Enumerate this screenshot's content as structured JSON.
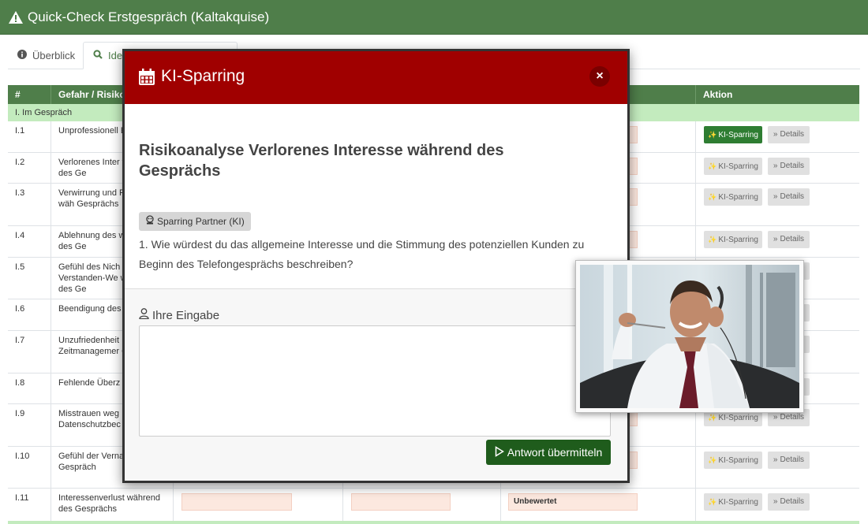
{
  "window": {
    "title": "Quick-Check Erstgespräch (Kaltakquise)"
  },
  "tabs": [
    {
      "label": "Überblick",
      "icon": "info-circle-icon"
    },
    {
      "label": "Ide",
      "icon": "search-icon"
    }
  ],
  "table": {
    "headers": [
      "#",
      "Gefahr / Risiko",
      "",
      "",
      "",
      "Aktion"
    ],
    "group_label": "I. Im Gespräch",
    "rows": [
      {
        "num": "I.1",
        "risk": "Unprofessionell Eindruck",
        "ki_active": true
      },
      {
        "num": "I.2",
        "risk": "Verlorenes Inter während des Ge",
        "ki_active": false
      },
      {
        "num": "I.3",
        "risk": "Verwirrung und Frustration wäh Gesprächs",
        "ki_active": false
      },
      {
        "num": "I.4",
        "risk": "Ablehnung des während des Ge",
        "ki_active": false
      },
      {
        "num": "I.5",
        "risk": "Gefühl des Nich Verstanden-We während des Ge",
        "ki_active": false
      },
      {
        "num": "I.6",
        "risk": "Beendigung des Gesprächs",
        "ki_active": false
      },
      {
        "num": "I.7",
        "risk": "Unzufriedenheit Zeitmanagemer Gespräch",
        "ki_active": false
      },
      {
        "num": "I.8",
        "risk": "Fehlende Überz Gespräch",
        "ki_active": false
      },
      {
        "num": "I.9",
        "risk": "Misstrauen weg Datenschutzbec Gespräch",
        "ki_active": false
      },
      {
        "num": "I.10",
        "risk": "Gefühl der Vernachlässigur Gespräch",
        "ki_active": false
      },
      {
        "num": "I.11",
        "risk": "Interessenverlust während des Gesprächs",
        "ki_active": false,
        "status": "Unbewertet"
      }
    ],
    "ki_button_label": "KI-Sparring",
    "details_button_label": "Details"
  },
  "modal": {
    "title": "KI-Sparring",
    "close_label": "×",
    "heading": "Risikoanalyse Verlorenes Interesse während des Gesprächs",
    "badge": "Sparring Partner (KI)",
    "question": "1. Wie würdest du das allgemeine Interesse und die Stimmung des potenziellen Kunden zu Beginn des Telefongesprächs beschreiben?",
    "input_label": "Ihre Eingabe",
    "input_value": "",
    "submit_label": "Antwort übermitteln"
  },
  "colors": {
    "header_green": "#4f7e4a",
    "group_green": "#c3ebbe",
    "modal_red": "#a00000",
    "submit_green": "#1f5c1c",
    "active_ki": "#2e7d32"
  }
}
